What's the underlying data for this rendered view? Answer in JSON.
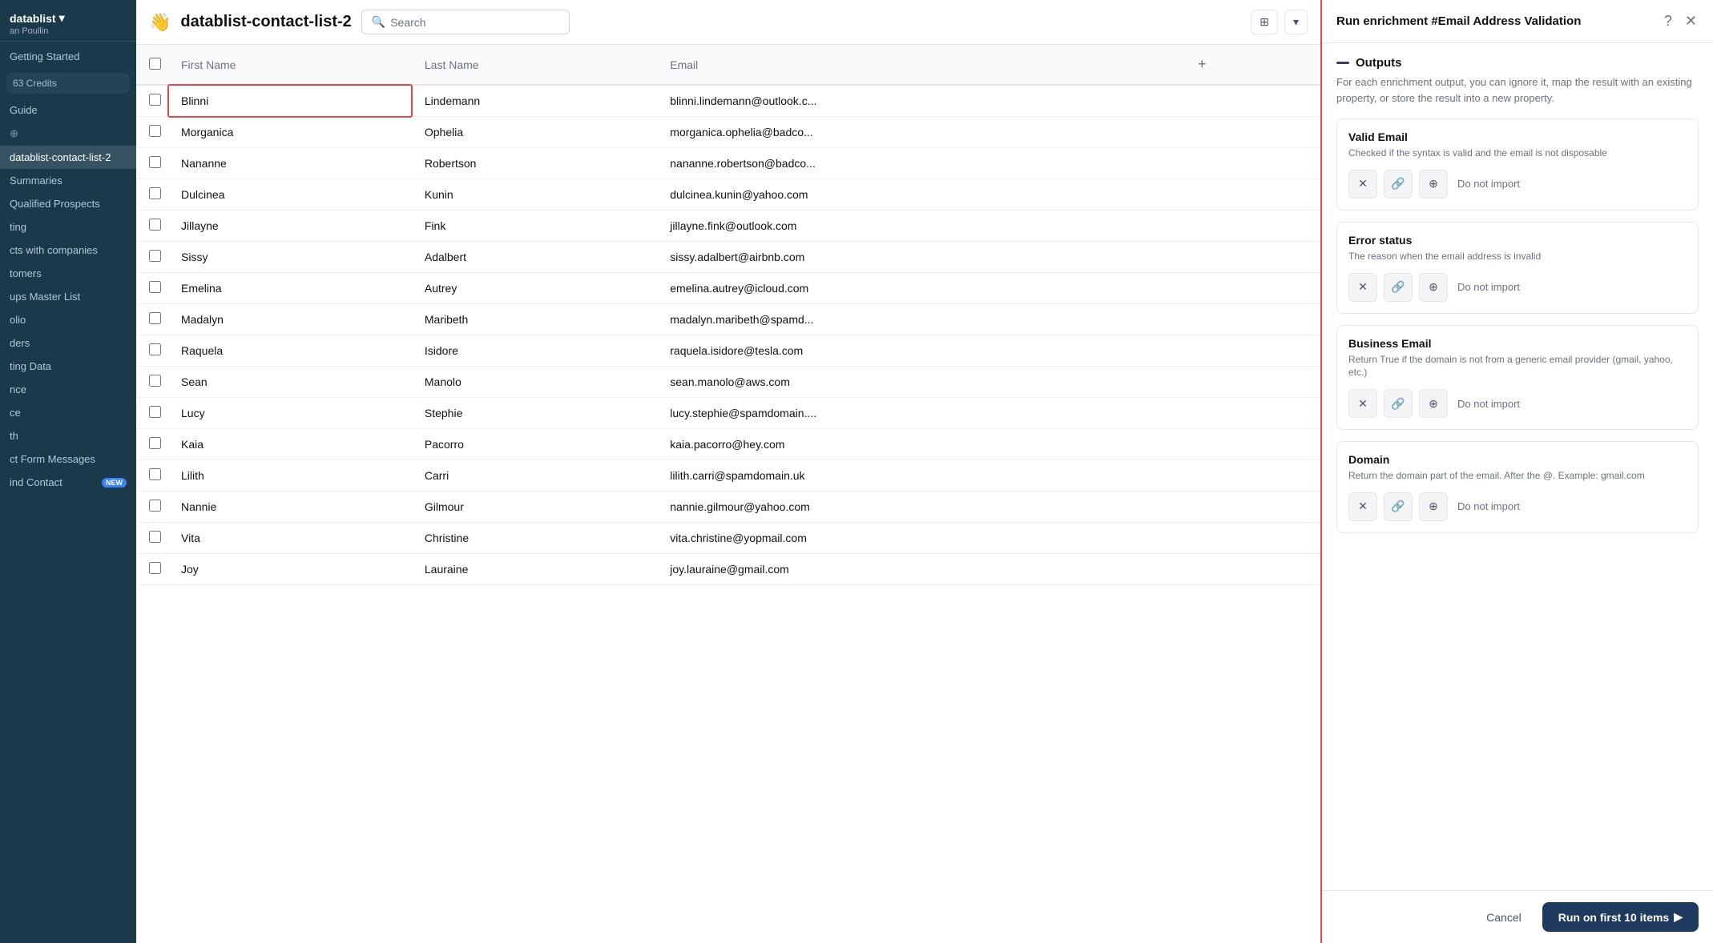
{
  "sidebar": {
    "app_name": "datablist",
    "app_chevron": "▾",
    "user": "an Poullin",
    "items": [
      {
        "id": "getting-started",
        "label": "Getting Started"
      },
      {
        "id": "credits",
        "label": "63 Credits",
        "special": "credits"
      },
      {
        "id": "guide",
        "label": "Guide"
      },
      {
        "id": "add-new",
        "label": "+ Add",
        "special": "add"
      },
      {
        "id": "datalist-contact-list-2",
        "label": "datablist-contact-list-2",
        "active": true
      },
      {
        "id": "summaries",
        "label": "Summaries"
      },
      {
        "id": "qualified-prospects",
        "label": "Qualified Prospects"
      },
      {
        "id": "ting",
        "label": "ting"
      },
      {
        "id": "cts-with-companies",
        "label": "cts with companies"
      },
      {
        "id": "tomers",
        "label": "tomers"
      },
      {
        "id": "ups-master-list",
        "label": "ups Master List"
      },
      {
        "id": "olio",
        "label": "olio"
      },
      {
        "id": "ders",
        "label": "ders"
      },
      {
        "id": "ting-data",
        "label": "ting Data"
      },
      {
        "id": "nce",
        "label": "nce"
      },
      {
        "id": "ce",
        "label": "ce"
      },
      {
        "id": "th",
        "label": "th"
      },
      {
        "id": "ct-form-messages",
        "label": "ct Form Messages"
      },
      {
        "id": "ind-contact-new",
        "label": "ind Contact",
        "badge": "New"
      }
    ]
  },
  "topbar": {
    "emoji": "👋",
    "title": "datablist-contact-list-2",
    "search_placeholder": "Search"
  },
  "table": {
    "columns": [
      "First Name",
      "Last Name",
      "Email"
    ],
    "rows": [
      {
        "first": "Blinni",
        "last": "Lindemann",
        "email": "blinni.lindemann@outlook.c...",
        "selected": true
      },
      {
        "first": "Morganica",
        "last": "Ophelia",
        "email": "morganica.ophelia@badco..."
      },
      {
        "first": "Nananne",
        "last": "Robertson",
        "email": "nananne.robertson@badco..."
      },
      {
        "first": "Dulcinea",
        "last": "Kunin",
        "email": "dulcinea.kunin@yahoo.com"
      },
      {
        "first": "Jillayne",
        "last": "Fink",
        "email": "jillayne.fink@outlook.com"
      },
      {
        "first": "Sissy",
        "last": "Adalbert",
        "email": "sissy.adalbert@airbnb.com"
      },
      {
        "first": "Emelina",
        "last": "Autrey",
        "email": "emelina.autrey@icloud.com"
      },
      {
        "first": "Madalyn",
        "last": "Maribeth",
        "email": "madalyn.maribeth@spamd..."
      },
      {
        "first": "Raquela",
        "last": "Isidore",
        "email": "raquela.isidore@tesla.com"
      },
      {
        "first": "Sean",
        "last": "Manolo",
        "email": "sean.manolo@aws.com"
      },
      {
        "first": "Lucy",
        "last": "Stephie",
        "email": "lucy.stephie@spamdomain...."
      },
      {
        "first": "Kaia",
        "last": "Pacorro",
        "email": "kaia.pacorro@hey.com"
      },
      {
        "first": "Lilith",
        "last": "Carri",
        "email": "lilith.carri@spamdomain.uk"
      },
      {
        "first": "Nannie",
        "last": "Gilmour",
        "email": "nannie.gilmour@yahoo.com"
      },
      {
        "first": "Vita",
        "last": "Christine",
        "email": "vita.christine@yopmail.com"
      },
      {
        "first": "Joy",
        "last": "Lauraine",
        "email": "joy.lauraine@gmail.com"
      }
    ]
  },
  "panel": {
    "title": "Run enrichment #Email Address Validation",
    "outputs_label": "Outputs",
    "outputs_desc": "For each enrichment output, you can ignore it, map the result with an existing property, or store the result into a new property.",
    "cards": [
      {
        "id": "valid-email",
        "title": "Valid Email",
        "desc": "Checked if the syntax is valid and the email is not disposable",
        "do_not_import": "Do not import"
      },
      {
        "id": "error-status",
        "title": "Error status",
        "desc": "The reason when the email address is invalid",
        "do_not_import": "Do not import"
      },
      {
        "id": "business-email",
        "title": "Business Email",
        "desc": "Return True if the domain is not from a generic email provider (gmail, yahoo, etc.)",
        "do_not_import": "Do not import"
      },
      {
        "id": "domain",
        "title": "Domain",
        "desc": "Return the domain part of the email. After the @. Example: gmail.com",
        "do_not_import": "Do not import"
      }
    ],
    "cancel_label": "Cancel",
    "run_label": "Run on first 10 items"
  }
}
